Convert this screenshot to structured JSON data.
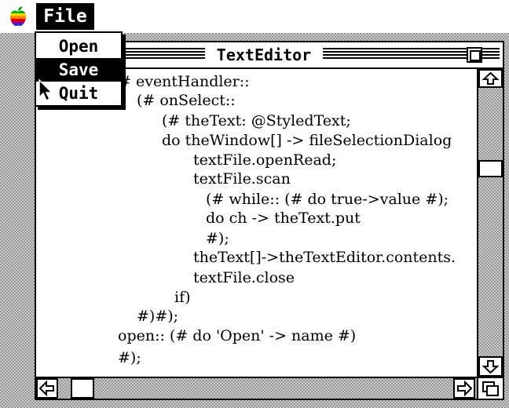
{
  "menubar": {
    "apple_menu_icon": "rainbow-apple-icon",
    "file_menu_title": "File"
  },
  "file_menu": {
    "items": [
      {
        "label": "Open",
        "selected": false
      },
      {
        "label": "Save",
        "selected": true
      },
      {
        "label": "Quit",
        "selected": false
      }
    ]
  },
  "window": {
    "title": "TextEditor",
    "code_lines": [
      "# eventHandler::",
      "(# onSelect::",
      "(# theText: @StyledText;",
      "do theWindow[] -> fileSelectionDialog",
      "textFile.openRead;",
      "textFile.scan",
      "(# while:: (# do true->value #);",
      "do ch -> theText.put",
      "#);",
      "theText[]->theTextEditor.contents.",
      "textFile.close",
      "if)",
      "#)#);",
      "open:: (# do 'Open' -> name #)",
      "#);"
    ]
  },
  "colors": {
    "desktop_pattern": "#9a9a9a",
    "window_bg": "#ffffff",
    "menu_highlight": "#000000"
  }
}
